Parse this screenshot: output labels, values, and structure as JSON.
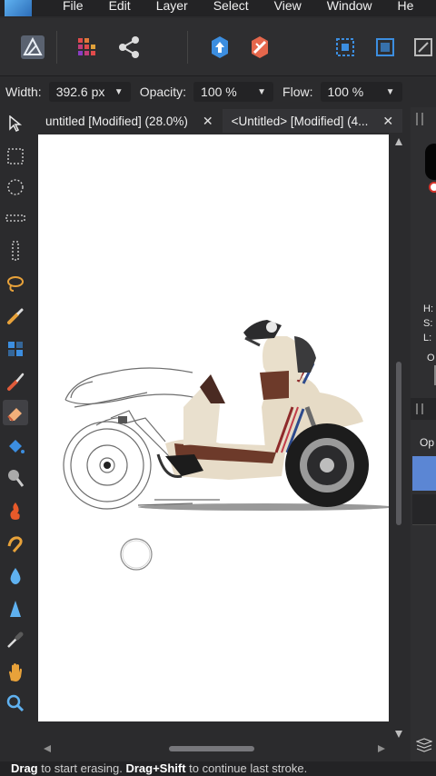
{
  "menu": [
    "File",
    "Edit",
    "Layer",
    "Select",
    "View",
    "Window",
    "He"
  ],
  "context": {
    "width_label": "Width:",
    "width_value": "392.6 px",
    "opacity_label": "Opacity:",
    "opacity_value": "100 %",
    "flow_label": "Flow:",
    "flow_value": "100 %"
  },
  "tabs": [
    {
      "label": "untitled [Modified] (28.0%)",
      "close": "✕"
    },
    {
      "label": "<Untitled> [Modified] (4...",
      "close": "✕"
    }
  ],
  "right_panel": {
    "h": "H:",
    "s": "S:",
    "l": "L:",
    "o": "O",
    "op": "Op"
  },
  "status": {
    "drag1": "Drag",
    "text1": " to start erasing. ",
    "drag2": "Drag+Shift",
    "text2": " to continue last stroke."
  },
  "colors": {
    "accent": "#3c8ee0",
    "panel": "#2b2b2d",
    "canvas": "#ffffff",
    "swatch": "#5b86d4"
  }
}
